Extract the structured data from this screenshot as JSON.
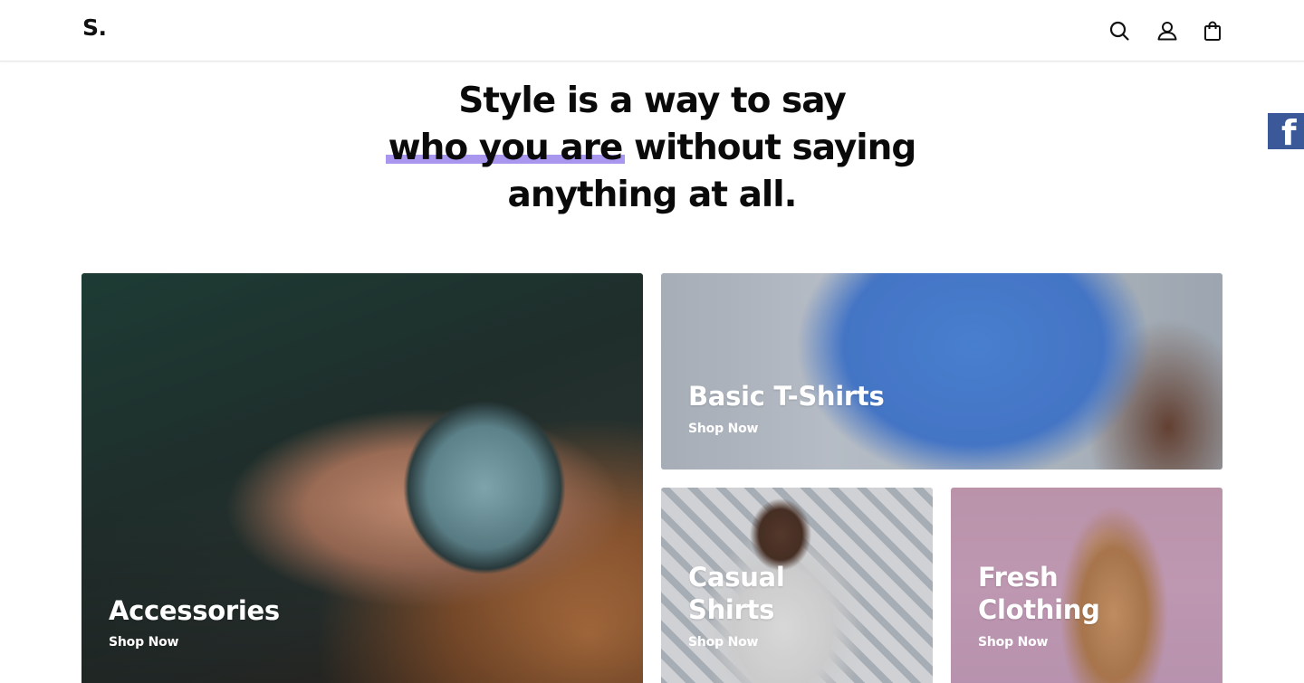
{
  "header": {
    "logo": "S.",
    "icons": [
      "search-icon",
      "user-icon",
      "shopping-bag-icon"
    ]
  },
  "social": {
    "facebook_glyph": "f"
  },
  "hero": {
    "line1": "Style is a way to say",
    "highlight": "who you are",
    "line2_rest": "without saying",
    "line3": "anything at all.",
    "highlight_color": "#a896ef"
  },
  "categories": [
    {
      "title": "Accessories",
      "cta": "Shop Now"
    },
    {
      "title": "Basic T-Shirts",
      "cta": "Shop Now"
    },
    {
      "title_line1": "Casual",
      "title_line2": "Shirts",
      "cta": "Shop Now"
    },
    {
      "title_line1": "Fresh",
      "title_line2": "Clothing",
      "cta": "Shop Now"
    }
  ],
  "colors": {
    "facebook": "#3b5998",
    "text": "#0a0a0a",
    "header_bg": "#ffffff"
  }
}
